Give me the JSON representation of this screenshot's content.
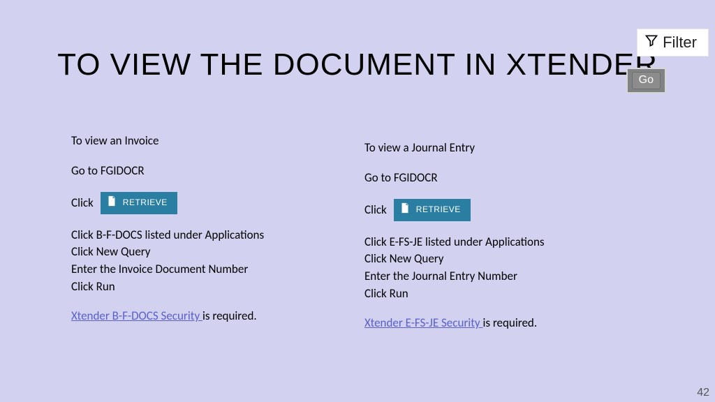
{
  "title": "TO VIEW THE DOCUMENT IN XTENDER",
  "filter_label": "Filter",
  "go_label": "Go",
  "retrieve_label": "RETRIEVE",
  "left": {
    "intro": "To view an Invoice",
    "goto": "Go to FGIDOCR",
    "click": "Click",
    "step1": "Click B-F-DOCS listed under Applications",
    "step2": "Click New Query",
    "step3": "Enter the Invoice Document Number",
    "step4": "Click Run",
    "link": "Xtender B-F-DOCS Security ",
    "req": "is required."
  },
  "right": {
    "intro": "To view a Journal Entry",
    "goto": "Go to FGIDOCR",
    "click": "Click",
    "step1": "Click E-FS-JE listed under Applications",
    "step2": "Click New Query",
    "step3": "Enter the Journal Entry Number",
    "step4": "Click Run",
    "link": "Xtender E-FS-JE Security ",
    "req": "is required."
  },
  "page_number": "42"
}
